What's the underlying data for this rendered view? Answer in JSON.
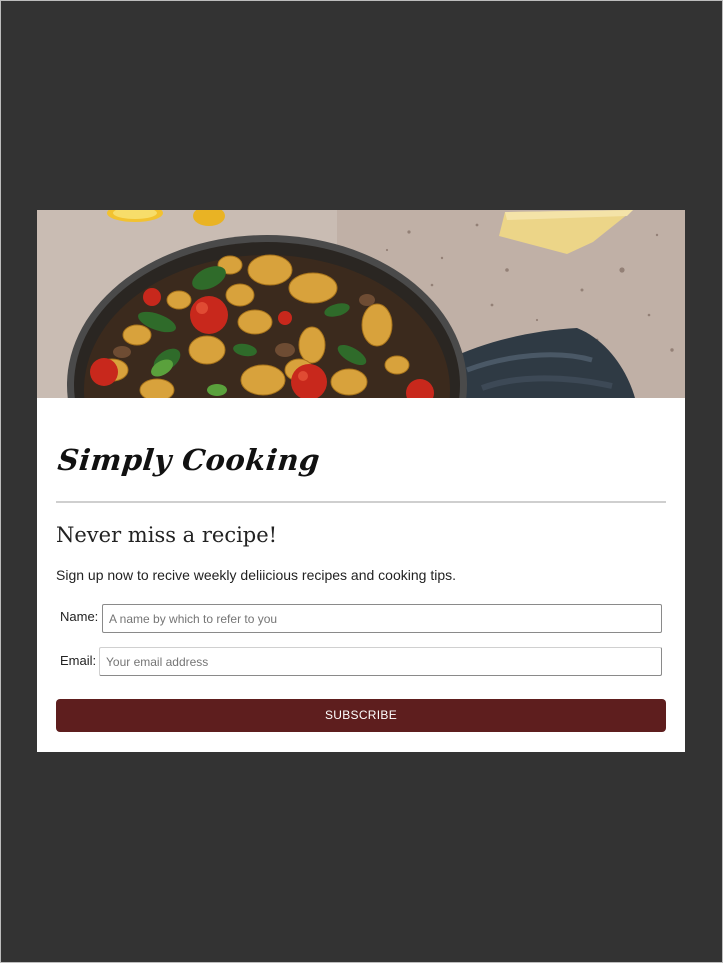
{
  "brand": {
    "name": "Simply Cooking"
  },
  "signup": {
    "headline": "Never miss a recipe!",
    "description": "Sign up now to recive weekly deliicious recipes and cooking tips.",
    "name_field": {
      "label": "Name:",
      "placeholder": "A name by which to refer to you",
      "value": ""
    },
    "email_field": {
      "label": "Email:",
      "placeholder": "Your email address",
      "value": ""
    },
    "subscribe_label": "SUBSCRIBE"
  },
  "colors": {
    "page_background": "#333333",
    "card_background": "#ffffff",
    "button_background": "#5e1e1e",
    "button_text": "#ffffff",
    "divider": "#cfcfcf"
  },
  "hero_image": {
    "subject": "pan of gnocchi with cherry tomatoes and basil"
  }
}
